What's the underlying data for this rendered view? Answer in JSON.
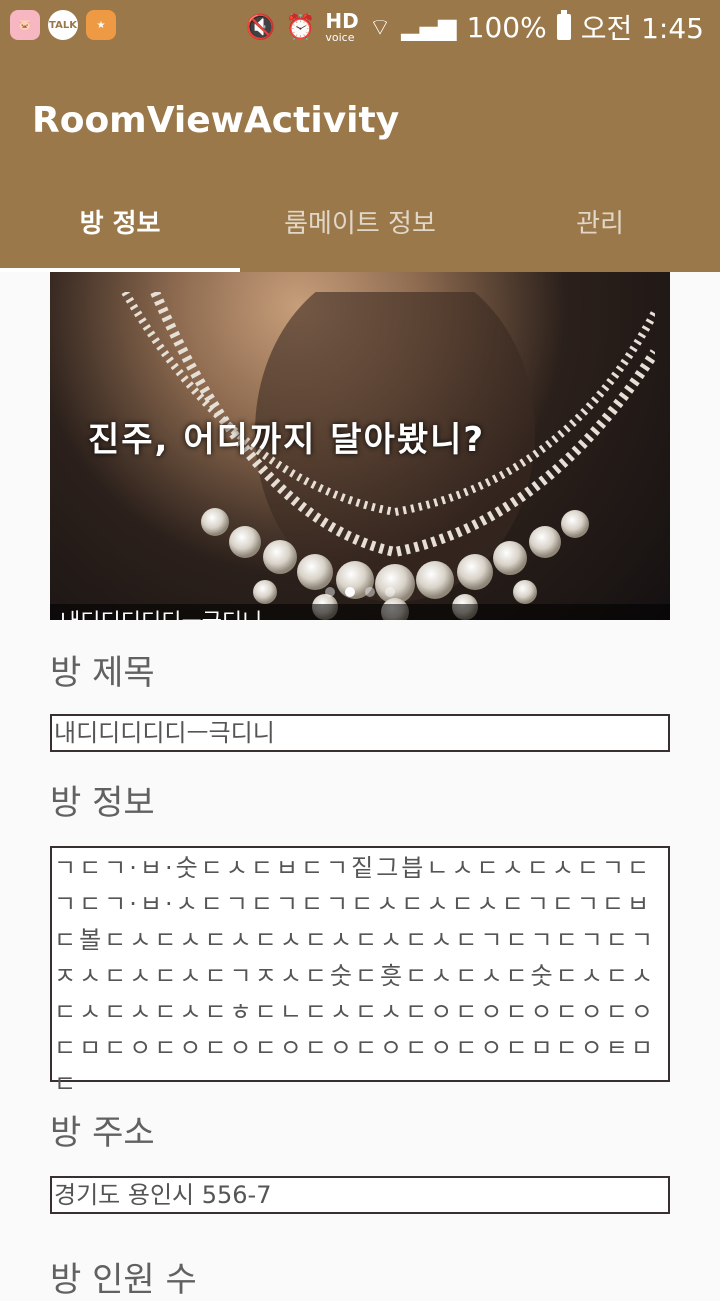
{
  "status_bar": {
    "battery": "100%",
    "time": "오전 1:45",
    "hd_label": "HD",
    "voice_label": "voice",
    "talk_label": "TALK"
  },
  "app": {
    "title": "RoomViewActivity",
    "accent": "#9a7849"
  },
  "tabs": [
    "방 정보",
    "룸메이트 정보",
    "관리"
  ],
  "carousel": {
    "banner_text": "진주, 어디까지 달아봤니?",
    "caption": "내디디디디디ㅡ극디니 ...",
    "pages": 4,
    "active_page": 2
  },
  "form": {
    "title_label": "방 제목",
    "title_value": "내디디디디디ㅡ극디니",
    "info_label": "방 정보",
    "info_value": "ㄱㄷㄱ·ㅂ·숫ㄷㅅㄷㅂㄷㄱ짙그븝ㄴㅅㄷㅅㄷㅅㄷㄱㄷㄱㄷㄱ·ㅂ·ㅅㄷㄱㄷㄱㄷㄱㄷㅅㄷㅅㄷㅅㄷㄱㄷㄱㄷㅂㄷ볼ㄷㅅㄷㅅㄷㅅㄷㅅㄷㅅㄷㅅㄷㅅㄷㄱㄷㄱㄷㄱㄷㄱㅈㅅㄷㅅㄷㅅㄷㄱㅈㅅㄷ숫ㄷ흣ㄷㅅㄷㅅㄷ숫ㄷㅅㄷㅅㄷㅅㄷㅅㄷㅅㄷㅎㄷㄴㄷㅅㄷㅅㄷㅇㄷㅇㄷㅇㄷㅇㄷㅇㄷㅁㄷㅇㄷㅇㄷㅇㄷㅇㄷㅇㄷㅇㄷㅇㄷㅇㄷㅁㄷㅇㅌㅁㄷ",
    "address_label": "방 주소",
    "address_value": "경기도 용인시 556-7",
    "count_label": "방 인원 수"
  }
}
